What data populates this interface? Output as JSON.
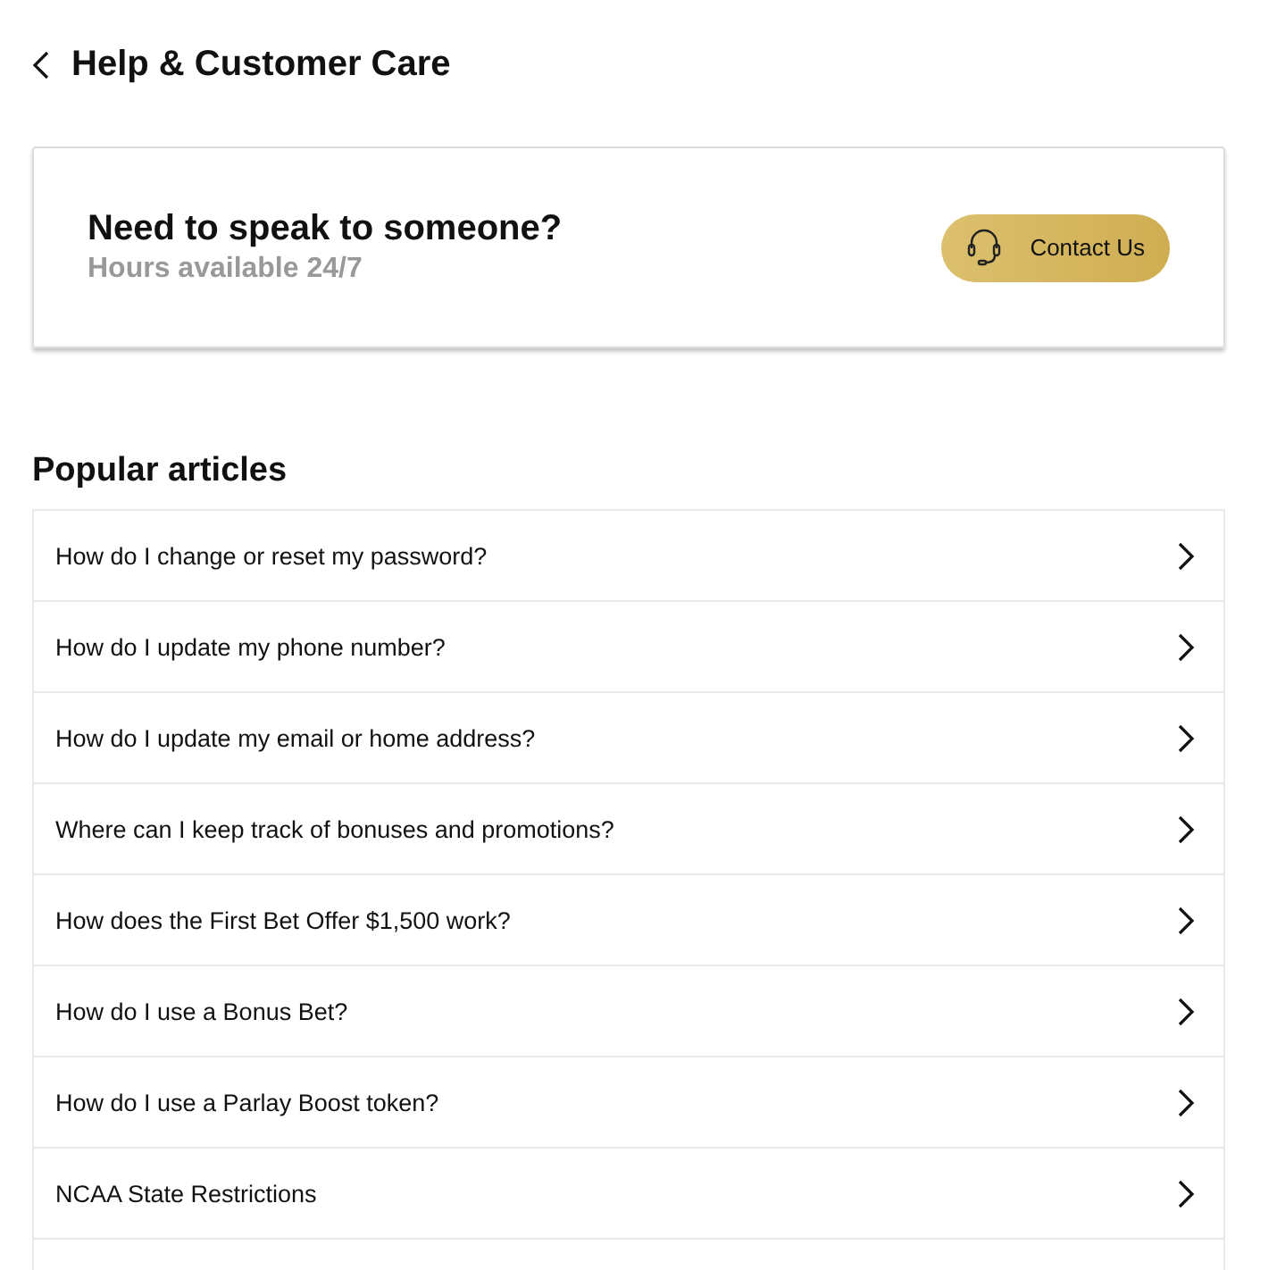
{
  "header": {
    "title": "Help & Customer Care"
  },
  "contact_card": {
    "title": "Need to speak to someone?",
    "subtitle": "Hours available 24/7",
    "button": "Contact Us"
  },
  "popular_articles": {
    "title": "Popular articles",
    "items": [
      {
        "label": "How do I change or reset my password?"
      },
      {
        "label": "How do I update my phone number?"
      },
      {
        "label": "How do I update my email or home address?"
      },
      {
        "label": "Where can I keep track of bonuses and promotions?"
      },
      {
        "label": "How does the First Bet Offer $1,500 work?"
      },
      {
        "label": "How do I use a Bonus Bet?"
      },
      {
        "label": "How do I use a Parlay Boost token?"
      },
      {
        "label": "NCAA State Restrictions"
      }
    ]
  }
}
